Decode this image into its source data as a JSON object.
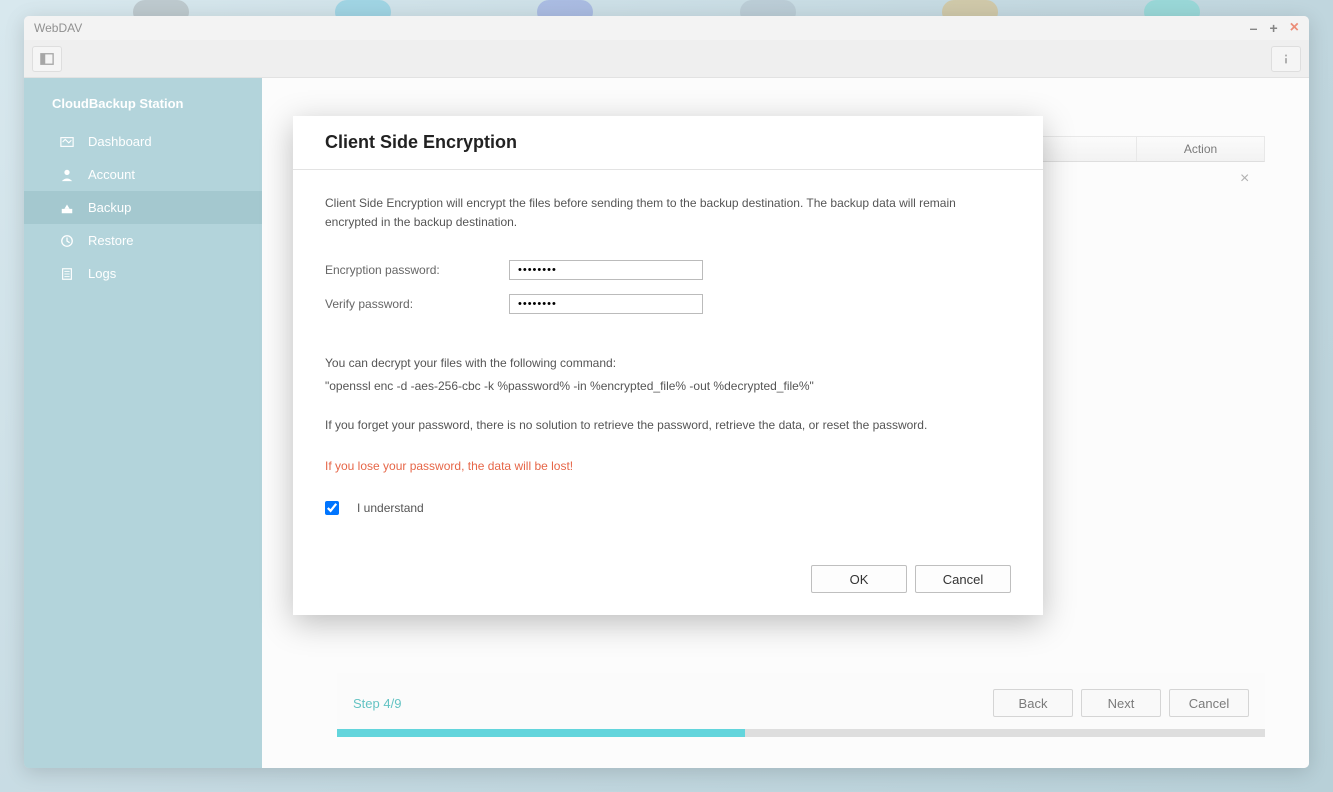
{
  "window": {
    "title": "WebDAV"
  },
  "sidebar": {
    "title": "CloudBackup Station",
    "items": [
      {
        "label": "Dashboard"
      },
      {
        "label": "Account"
      },
      {
        "label": "Backup"
      },
      {
        "label": "Restore"
      },
      {
        "label": "Logs"
      }
    ]
  },
  "table": {
    "action_header": "Action"
  },
  "wizard": {
    "step_label": "Step 4/9",
    "back": "Back",
    "next": "Next",
    "cancel": "Cancel"
  },
  "modal": {
    "title": "Client Side Encryption",
    "description": "Client Side Encryption will encrypt the files before sending them to the backup destination. The backup data will remain encrypted in the backup destination.",
    "password_label": "Encryption password:",
    "password_value": "••••••••",
    "verify_label": "Verify password:",
    "verify_value": "••••••••",
    "decrypt_intro": "You can decrypt your files with the following command:",
    "decrypt_cmd": "\"openssl enc -d -aes-256-cbc -k %password% -in %encrypted_file% -out %decrypted_file%\"",
    "forget_line": "If you forget your password, there is no solution to retrieve the password, retrieve the data, or reset the password.",
    "warning": "If you lose your password, the data will be lost!",
    "understand_label": "I understand",
    "understand_checked": true,
    "ok": "OK",
    "cancel": "Cancel"
  }
}
